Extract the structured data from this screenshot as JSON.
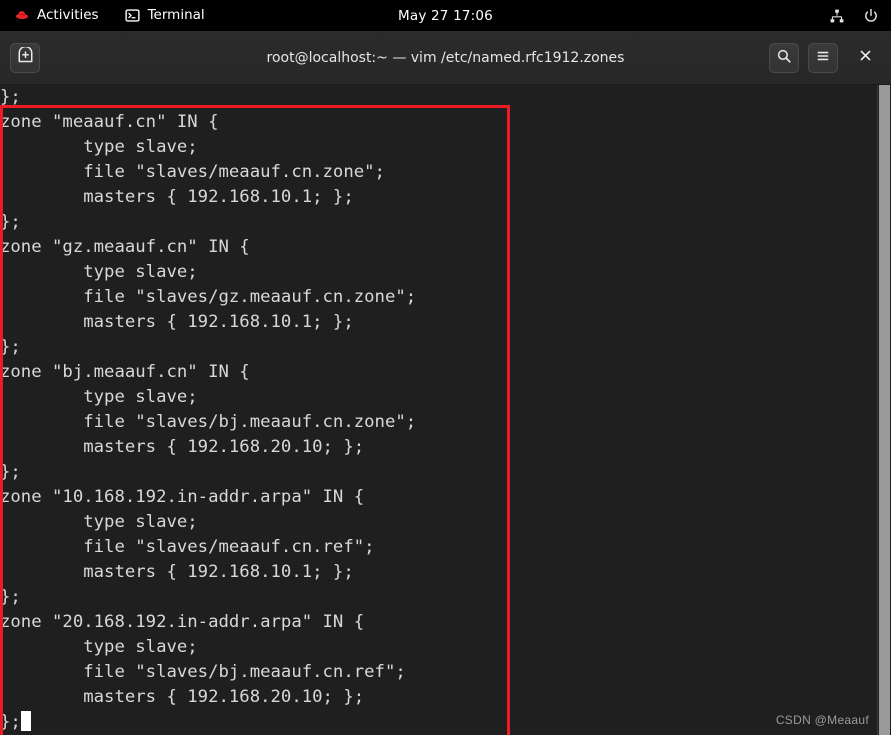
{
  "topbar": {
    "activities_label": "Activities",
    "activities_icon": "redhat-logo-icon",
    "app_label": "Terminal",
    "app_icon": "terminal-prompt-icon",
    "clock": "May 27  17:06",
    "network_icon": "network-nodes-icon",
    "power_icon": "power-icon"
  },
  "window": {
    "title": "root@localhost:~ — vim /etc/named.rfc1912.zones",
    "new_tab_icon": "new-terminal-tab-icon",
    "search_icon": "search-icon",
    "menu_icon": "hamburger-menu-icon",
    "close_icon": "close-icon"
  },
  "terminal": {
    "background": "#1f1f1f",
    "foreground": "#d8d8d8",
    "lines": [
      "};",
      "zone \"meaauf.cn\" IN {",
      "        type slave;",
      "        file \"slaves/meaauf.cn.zone\";",
      "        masters { 192.168.10.1; };",
      "};",
      "zone \"gz.meaauf.cn\" IN {",
      "        type slave;",
      "        file \"slaves/gz.meaauf.cn.zone\";",
      "        masters { 192.168.10.1; };",
      "};",
      "zone \"bj.meaauf.cn\" IN {",
      "        type slave;",
      "        file \"slaves/bj.meaauf.cn.zone\";",
      "        masters { 192.168.20.10; };",
      "};",
      "zone \"10.168.192.in-addr.arpa\" IN {",
      "        type slave;",
      "        file \"slaves/meaauf.cn.ref\";",
      "        masters { 192.168.10.1; };",
      "};",
      "zone \"20.168.192.in-addr.arpa\" IN {",
      "        type slave;",
      "        file \"slaves/bj.meaauf.cn.ref\";",
      "        masters { 192.168.20.10; };",
      "};"
    ],
    "cursor_line_text": "};",
    "cursor_visible": true,
    "highlight_color": "#ed1c24",
    "watermark": "CSDN @Meaauf",
    "scrollbar_color": "#9a9a9a"
  }
}
